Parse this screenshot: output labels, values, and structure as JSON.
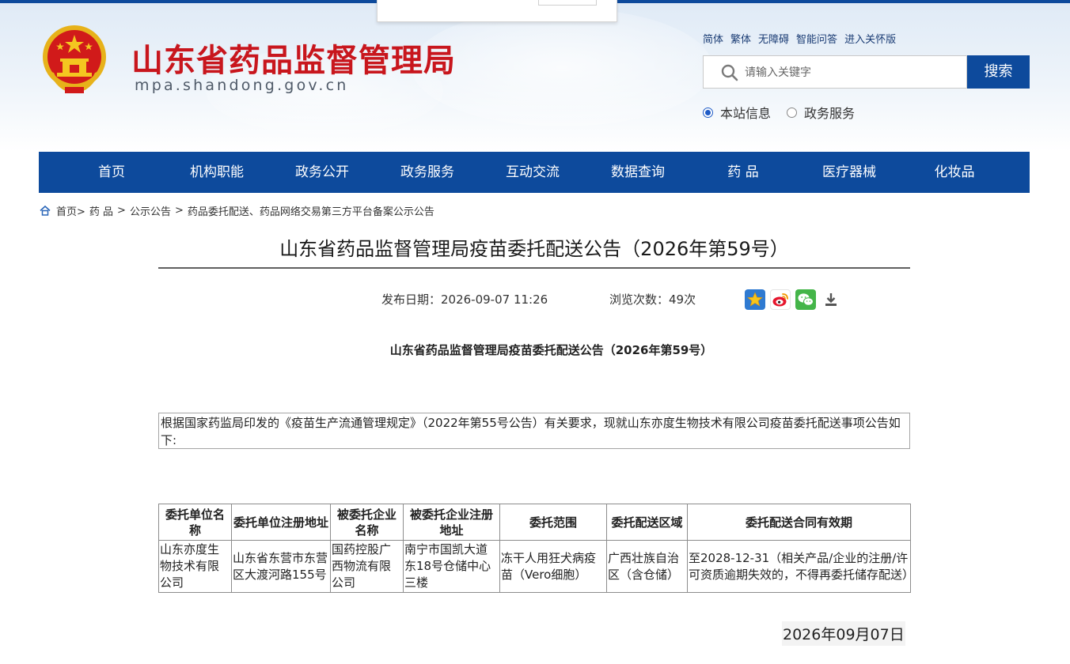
{
  "header": {
    "site_title": "山东省药品监督管理局",
    "site_domain": "mpa.shandong.gov.cn",
    "top_links": [
      "简体",
      "繁体",
      "无障碍",
      "智能问答",
      "进入关怀版"
    ],
    "search": {
      "placeholder": "请输入关键字",
      "button_label": "搜索"
    },
    "scope_options": [
      {
        "label": "本站信息",
        "selected": true
      },
      {
        "label": "政务服务",
        "selected": false
      }
    ]
  },
  "nav": {
    "items": [
      "首页",
      "机构职能",
      "政务公开",
      "政务服务",
      "互动交流",
      "数据查询",
      "药 品",
      "医疗器械",
      "化妆品"
    ]
  },
  "breadcrumb": {
    "items": [
      "首页>",
      "药 品",
      ">",
      "公示公告",
      ">",
      "药品委托配送、药品网络交易第三方平台备案公示公告"
    ]
  },
  "article": {
    "title": "山东省药品监督管理局疫苗委托配送公告（2026年第59号）",
    "publish_date": "发布日期：2026-09-07 11:26",
    "view_count": "浏览次数：49次",
    "share_icons": [
      "favorite-star-icon",
      "weibo-icon",
      "wechat-icon",
      "download-icon"
    ],
    "subtitle": "山东省药品监督管理局疫苗委托配送公告（2026年第59号）",
    "intro": "根据国家药监局印发的《疫苗生产流通管理规定》（2022年第55号公告）有关要求，现就山东亦度生物技术有限公司疫苗委托配送事项公告如下:",
    "table": {
      "headers": [
        "委托单位名称",
        "委托单位注册地址",
        "被委托企业名称",
        "被委托企业注册地址",
        "委托范围",
        "委托配送区域",
        "委托配送合同有效期"
      ],
      "rows": [
        [
          "山东亦度生物技术有限公司",
          "山东省东营市东营区大渡河路155号",
          "国药控股广西物流有限公司",
          "南宁市国凯大道东18号仓储中心三楼",
          "冻干人用狂犬病疫苗（Vero细胞）",
          "广西壮族自治区（含仓储）",
          "至2028-12-31（相关产品/企业的注册/许可资质逾期失效的，不得再委托储存配送）"
        ]
      ]
    },
    "sign_date": "2026年09月07日"
  },
  "colors": {
    "brand_blue": "#0d4a9c",
    "title_red": "#c8161d"
  }
}
